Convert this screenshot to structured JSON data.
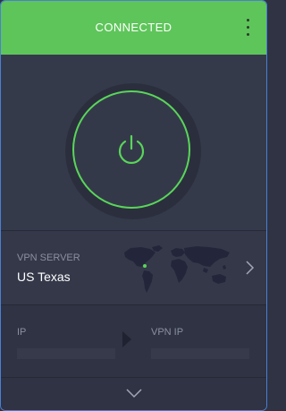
{
  "header": {
    "status": "CONNECTED",
    "menu_icon": "kebab-menu-icon",
    "color": "#5ec55a"
  },
  "power": {
    "icon": "power-icon",
    "ring_color": "#59d65a"
  },
  "server": {
    "label": "VPN SERVER",
    "name": "US Texas",
    "map_icon": "world-map-icon",
    "chevron_icon": "chevron-right-icon"
  },
  "ip": {
    "left_label": "IP",
    "right_label": "VPN IP",
    "arrow_icon": "arrow-right-icon"
  },
  "footer": {
    "expand_icon": "chevron-down-icon"
  }
}
